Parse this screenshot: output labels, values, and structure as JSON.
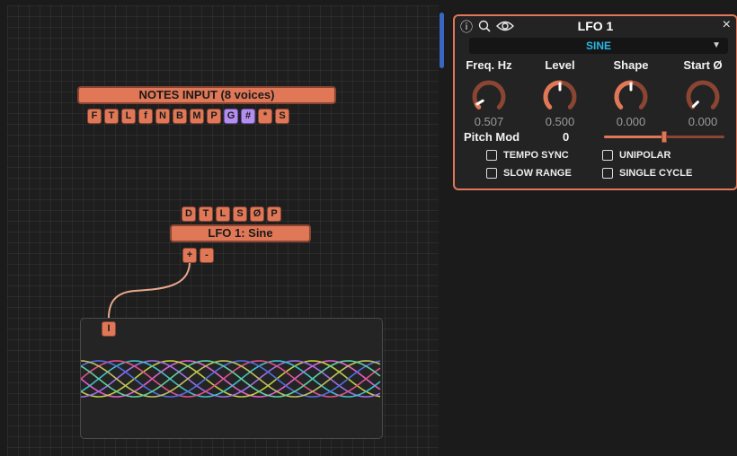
{
  "notes_module": {
    "title": "NOTES INPUT  (8 voices)",
    "tags": [
      {
        "label": "F",
        "purple": false
      },
      {
        "label": "T",
        "purple": false
      },
      {
        "label": "L",
        "purple": false
      },
      {
        "label": "f",
        "purple": false
      },
      {
        "label": "N",
        "purple": false
      },
      {
        "label": "B",
        "purple": false
      },
      {
        "label": "M",
        "purple": false
      },
      {
        "label": "P",
        "purple": false
      },
      {
        "label": "G",
        "purple": true
      },
      {
        "label": "#",
        "purple": true
      },
      {
        "label": "*",
        "purple": false
      },
      {
        "label": "S",
        "purple": false
      }
    ]
  },
  "lfo_module": {
    "title": "LFO 1: Sine",
    "tags": [
      "D",
      "T",
      "L",
      "S",
      "Ø",
      "P"
    ],
    "plus": "+",
    "minus": "-"
  },
  "scope_module": {
    "input_tag": "I",
    "wave_colors": [
      "#e060d0",
      "#c0d040",
      "#9e6ee8",
      "#40c0c8",
      "#e0508a",
      "#5070e0",
      "#c0c060",
      "#60d0a0"
    ]
  },
  "lfo_panel": {
    "title": "LFO 1",
    "icons": [
      "info-icon",
      "search-icon",
      "eye-icon"
    ],
    "close": "×",
    "waveform": "SINE",
    "knobs": [
      {
        "label": "Freq. Hz",
        "value": "0.507",
        "level": 0.05
      },
      {
        "label": "Level",
        "value": "0.500",
        "level": 0.5
      },
      {
        "label": "Shape",
        "value": "0.000",
        "level": 0.5
      },
      {
        "label": "Start Ø",
        "value": "0.000",
        "level": 0.0
      }
    ],
    "pitch_mod": {
      "label": "Pitch Mod",
      "value": "0",
      "slider_level": 0.5
    },
    "options": {
      "tempo_sync": "TEMPO SYNC",
      "unipolar": "UNIPOLAR",
      "slow_range": "SLOW RANGE",
      "single_cycle": "SINGLE CYCLE"
    },
    "accent": "#e07858"
  }
}
